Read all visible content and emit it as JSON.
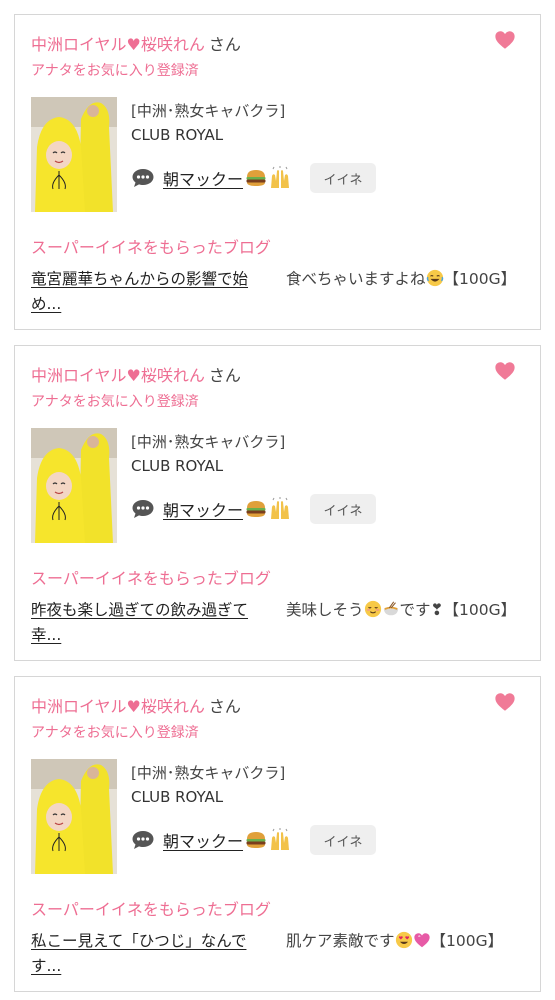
{
  "accent_color": "#ee6e93",
  "cards": [
    {
      "shop_name": "中洲ロイヤル",
      "name_heart": "♥",
      "girl_name": "桜咲れん",
      "honorific": "さん",
      "favorite_status": "アナタをお気に入り登録済",
      "shop_genre": "[中洲･熟女キャバクラ]",
      "club_name": "CLUB ROYAL",
      "blog_title": "朝マックー",
      "iine_label": "イイネ",
      "super_label": "スーパーイイネをもらったブログ",
      "liked_blog_title": "竜宮麗華ちゃんからの影響で始め...",
      "comment_text": "食べちゃいますよね",
      "comment_points": "【100G】",
      "comment_emoji": [
        "joy-emoji"
      ]
    },
    {
      "shop_name": "中洲ロイヤル",
      "name_heart": "♥",
      "girl_name": "桜咲れん",
      "honorific": "さん",
      "favorite_status": "アナタをお気に入り登録済",
      "shop_genre": "[中洲･熟女キャバクラ]",
      "club_name": "CLUB ROYAL",
      "blog_title": "朝マックー",
      "iine_label": "イイネ",
      "super_label": "スーパーイイネをもらったブログ",
      "liked_blog_title": "昨夜も楽し過ぎての飲み過ぎて幸...",
      "comment_text": "美味しそう",
      "comment_text_after": "です❣",
      "comment_points": "【100G】",
      "comment_emoji": [
        "relieved-emoji",
        "noodle-emoji"
      ]
    },
    {
      "shop_name": "中洲ロイヤル",
      "name_heart": "♥",
      "girl_name": "桜咲れん",
      "honorific": "さん",
      "favorite_status": "アナタをお気に入り登録済",
      "shop_genre": "[中洲･熟女キャバクラ]",
      "club_name": "CLUB ROYAL",
      "blog_title": "朝マックー",
      "iine_label": "イイネ",
      "super_label": "スーパーイイネをもらったブログ",
      "liked_blog_title": "私こー見えて「ひつじ」なんです...",
      "comment_text": "肌ケア素敵です",
      "comment_points": "【100G】",
      "comment_emoji": [
        "heart-eyes-emoji",
        "pink-heart-emoji"
      ]
    }
  ]
}
